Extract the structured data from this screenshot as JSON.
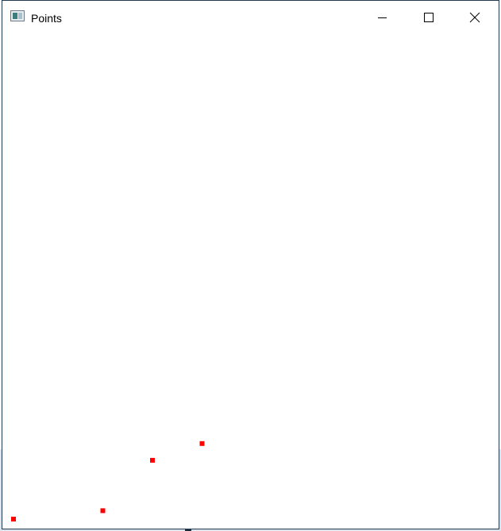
{
  "window": {
    "title": "Points",
    "icon": "app-window-icon",
    "controls": {
      "minimize": "minimize-icon",
      "maximize": "maximize-icon",
      "close": "close-icon"
    }
  },
  "chart_data": {
    "type": "scatter",
    "title": "",
    "xlabel": "",
    "ylabel": "",
    "grid": false,
    "legend": "none",
    "marker_color": "#ff0000",
    "marker_shape": "square",
    "series": [
      {
        "x": [
          0,
          18,
          28,
          38
        ],
        "y": [
          0,
          2,
          14,
          18
        ]
      }
    ],
    "xlim": [
      0,
      100
    ],
    "ylim": [
      0,
      100
    ]
  },
  "colors": {
    "marker": "#ff0000",
    "background": "#ffffff",
    "border": "#1f3a52"
  }
}
